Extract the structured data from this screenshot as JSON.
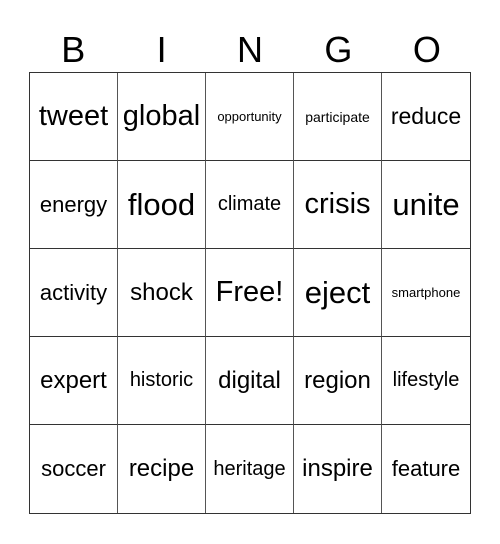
{
  "header": [
    "B",
    "I",
    "N",
    "G",
    "O"
  ],
  "cells": [
    [
      "tweet",
      "global",
      "opportunity",
      "participate",
      "reduce"
    ],
    [
      "energy",
      "flood",
      "climate",
      "crisis",
      "unite"
    ],
    [
      "activity",
      "shock",
      "Free!",
      "eject",
      "smartphone"
    ],
    [
      "expert",
      "historic",
      "digital",
      "region",
      "lifestyle"
    ],
    [
      "soccer",
      "recipe",
      "heritage",
      "inspire",
      "feature"
    ]
  ]
}
